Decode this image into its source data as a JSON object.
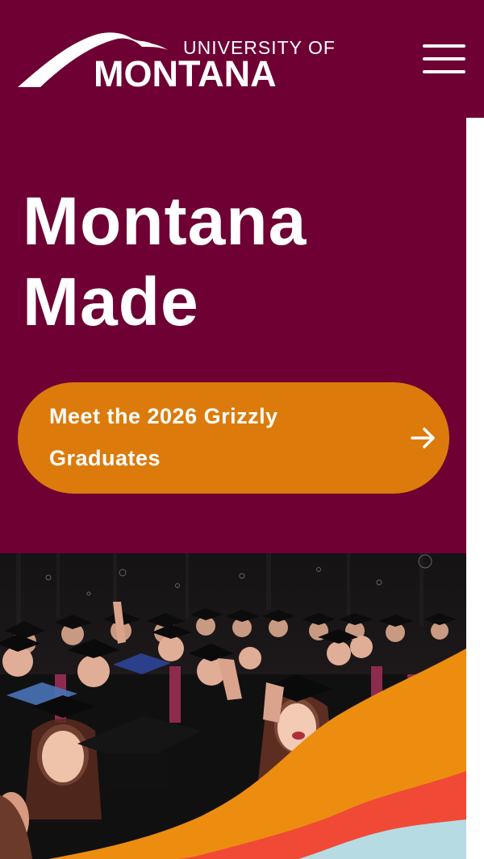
{
  "header": {
    "logo_top": "UNIVERSITY OF",
    "logo_main": "MONTANA",
    "menu_icon": "hamburger-menu-icon",
    "background_color": "#6e0033"
  },
  "hero": {
    "title_line1": "Montana",
    "title_line2": "Made",
    "cta_label": "Meet the 2026 Grizzly Graduates",
    "cta_icon": "arrow-right-icon",
    "cta_color": "#dc7b0b"
  },
  "photo": {
    "subject": "graduation-photo",
    "wave_colors": [
      "#ec8d0f",
      "#f04a37",
      "#b7dbe3"
    ]
  }
}
